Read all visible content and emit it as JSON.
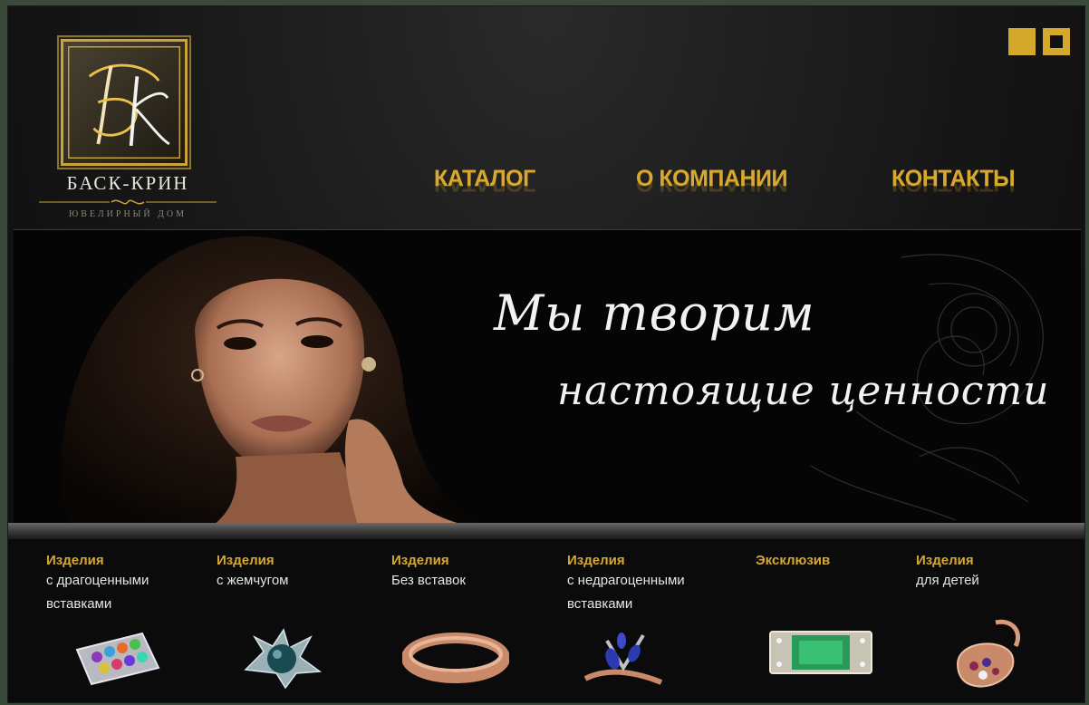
{
  "brand": {
    "name": "БАСК-КРИН",
    "tagline": "ЮВЕЛИРНЫЙ ДОМ",
    "accent": "#d8a930"
  },
  "nav": {
    "items": [
      {
        "label": "КАТАЛОГ"
      },
      {
        "label": "О КОМПАНИИ"
      },
      {
        "label": "КОНТАКТЫ"
      }
    ]
  },
  "banner": {
    "line1": "Мы творим",
    "line2": "настоящие ценности"
  },
  "categories": [
    {
      "title": "Изделия",
      "desc": "с драгоценными вставками",
      "icon": "gem-ring-icon"
    },
    {
      "title": "Изделия",
      "desc": "с жемчугом",
      "icon": "pearl-ring-icon"
    },
    {
      "title": "Изделия",
      "desc": "Без вставок",
      "icon": "gold-band-icon"
    },
    {
      "title": "Изделия",
      "desc": "с недрагоценными вставками",
      "icon": "sapphire-ring-icon"
    },
    {
      "title": "Эксклюзив",
      "desc": "",
      "icon": "emerald-ring-icon"
    },
    {
      "title": "Изделия",
      "desc": "для детей",
      "icon": "pendant-icon"
    }
  ]
}
